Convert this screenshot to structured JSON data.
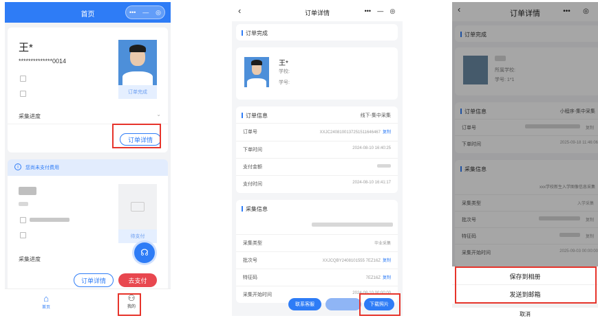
{
  "phone1": {
    "header_title": "首页",
    "capsule": {
      "more": "•••",
      "minus": "—",
      "target": "◎"
    },
    "card1": {
      "name": "王*",
      "id_masked": "**************0014",
      "photo_status": "订单完成",
      "progress_label": "采集进度",
      "detail_button": "订单详情"
    },
    "notice": "您尚未支付费用",
    "card2": {
      "name": "王*",
      "photo_status": "待支付",
      "progress_label": "采集进度",
      "detail_button": "订单详情",
      "pay_button": "去支付"
    },
    "tabbar": {
      "home": "首页",
      "mine": "我的"
    }
  },
  "phone2": {
    "header_title": "订单详情",
    "capsule": {
      "more": "•••",
      "minus": "—",
      "target": "◎"
    },
    "status_section": "订单完成",
    "student": {
      "name": "王*",
      "school_label": "学校:",
      "id_label": "学号:"
    },
    "order_info": {
      "title": "订单信息",
      "channel": "线下-集中采集",
      "rows": [
        {
          "k": "订单号",
          "v": "XXJC2408100137251511646467",
          "copy": "复制"
        },
        {
          "k": "下单时间",
          "v": "2024-08-10 16:40:25"
        },
        {
          "k": "支付金额",
          "v": ""
        },
        {
          "k": "支付时间",
          "v": "2024-08-10 16:41:17"
        }
      ]
    },
    "collect_info": {
      "title": "采集信息",
      "rows": [
        {
          "k": "采集类型",
          "v": "毕业采集"
        },
        {
          "k": "批次号",
          "v": "XXJCQBY2408101555 7EZ16Z",
          "copy": "复制"
        },
        {
          "k": "特征码",
          "v": "7EZ16Z",
          "copy": "复制"
        },
        {
          "k": "采集开始时间",
          "v": "2024-08-10 00:00:00"
        }
      ]
    },
    "buttons": {
      "service": "联系客服",
      "download": "下载照片"
    }
  },
  "phone3": {
    "header_title": "订单详情",
    "capsule": {
      "more": "•••",
      "target": "◎"
    },
    "status_section": "订单完成",
    "student": {
      "school_label": "所属学校:",
      "id_label": "学号: 1*1"
    },
    "order_info": {
      "title": "订单信息",
      "channel": "小程序-集中采集",
      "rows": [
        {
          "k": "订单号",
          "v": "",
          "copy": "复制"
        },
        {
          "k": "下单时间",
          "v": "2025-09-18 11:46:06"
        }
      ]
    },
    "collect_info": {
      "title": "采集信息",
      "subtitle": "xxx学校新生入学图像信息采集",
      "rows": [
        {
          "k": "采集类型",
          "v": "入学采集"
        },
        {
          "k": "批次号",
          "v": "",
          "copy": "复制"
        },
        {
          "k": "特征码",
          "v": "",
          "copy": "复制"
        },
        {
          "k": "采集开始时间",
          "v": "2025-09-03 00:00:00"
        }
      ]
    },
    "sheet": {
      "save": "保存到相册",
      "email": "发送到邮箱",
      "cancel": "取消"
    }
  }
}
